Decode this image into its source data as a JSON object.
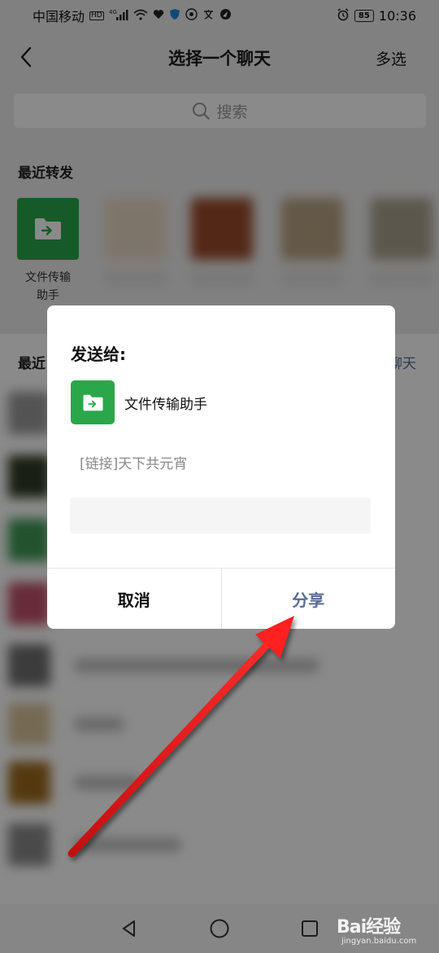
{
  "status_bar": {
    "carrier": "中国移动",
    "hd": "HD",
    "signal": "4G",
    "battery": "85",
    "time": "10:36"
  },
  "nav": {
    "title": "选择一个聊天",
    "right_action": "多选"
  },
  "search": {
    "placeholder": "搜索"
  },
  "recent_forwarded": {
    "label": "最近转发",
    "items": [
      {
        "name": "文件传输\n助手"
      }
    ]
  },
  "recent_chats": {
    "label": "最近",
    "action": "聊天"
  },
  "dialog": {
    "title": "发送给:",
    "recipient_name": "文件传输助手",
    "content": "[链接]天下共元宵",
    "cancel_label": "取消",
    "share_label": "分享"
  },
  "watermark": {
    "brand": "Bai经验",
    "url": "jingyan.baidu.com"
  },
  "colors": {
    "accent_green": "#2aa74a",
    "link_blue": "#576b95",
    "annotation_red": "#e01a1a"
  }
}
